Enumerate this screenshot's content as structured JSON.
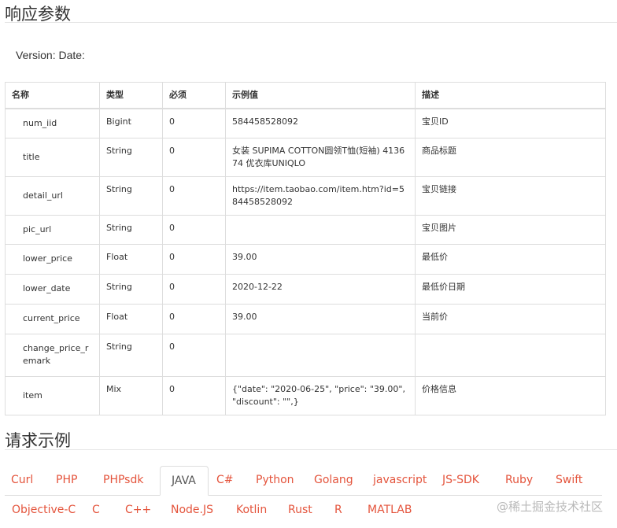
{
  "response_section": {
    "title": "响应参数",
    "version_text": "Version: Date:"
  },
  "table": {
    "headers": [
      "名称",
      "类型",
      "必须",
      "示例值",
      "描述"
    ],
    "rows": [
      {
        "name": "num_iid",
        "type": "Bigint",
        "required": "0",
        "example": "584458528092",
        "desc": "宝贝ID"
      },
      {
        "name": "title",
        "type": "String",
        "required": "0",
        "example": "女装 SUPIMA COTTON圆领T恤(短袖) 413674 优衣库UNIQLO",
        "desc": "商品标题"
      },
      {
        "name": "detail_url",
        "type": "String",
        "required": "0",
        "example": "https://item.taobao.com/item.htm?id=584458528092",
        "desc": "宝贝链接"
      },
      {
        "name": "pic_url",
        "type": "String",
        "required": "0",
        "example": "",
        "desc": "宝贝图片"
      },
      {
        "name": "lower_price",
        "type": "Float",
        "required": "0",
        "example": "39.00",
        "desc": "最低价"
      },
      {
        "name": "lower_date",
        "type": "String",
        "required": "0",
        "example": "2020-12-22",
        "desc": "最低价日期"
      },
      {
        "name": "current_price",
        "type": "Float",
        "required": "0",
        "example": "39.00",
        "desc": "当前价"
      },
      {
        "name": "change_price_remark",
        "type": "String",
        "required": "0",
        "example": "",
        "desc": ""
      },
      {
        "name": "item",
        "type": "Mix",
        "required": "0",
        "example": "{\"date\": \"2020-06-25\", \"price\": \"39.00\", \"discount\": \"\",}",
        "desc": "价格信息"
      }
    ]
  },
  "request_section": {
    "title": "请求示例"
  },
  "tabs": [
    {
      "label": "Curl",
      "active": false
    },
    {
      "label": "PHP",
      "active": false
    },
    {
      "label": "PHPsdk",
      "active": false
    },
    {
      "label": "JAVA",
      "active": true
    },
    {
      "label": "C#",
      "active": false
    },
    {
      "label": "Python",
      "active": false
    },
    {
      "label": "Golang",
      "active": false
    },
    {
      "label": "javascript",
      "active": false
    },
    {
      "label": "JS-SDK",
      "active": false
    },
    {
      "label": "Ruby",
      "active": false
    },
    {
      "label": "Swift",
      "active": false
    },
    {
      "label": "Objective-C",
      "active": false
    },
    {
      "label": "C",
      "active": false
    },
    {
      "label": "C++",
      "active": false
    },
    {
      "label": "Node.JS",
      "active": false
    },
    {
      "label": "Kotlin",
      "active": false
    },
    {
      "label": "Rust",
      "active": false
    },
    {
      "label": "R",
      "active": false
    },
    {
      "label": "MATLAB",
      "active": false
    }
  ],
  "watermark": "@稀土掘金技术社区",
  "colors": {
    "tab_link": "#e4543c",
    "border": "#dddddd",
    "text": "#333333"
  }
}
